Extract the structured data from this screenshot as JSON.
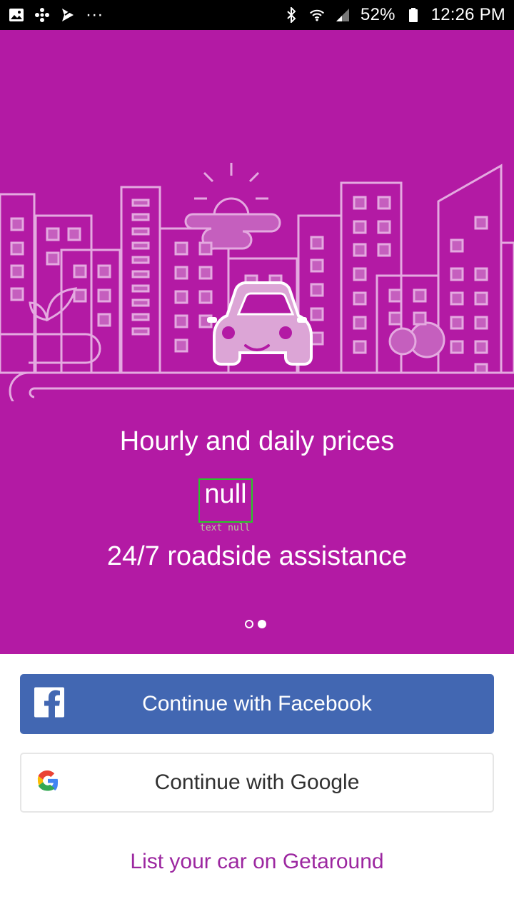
{
  "status_bar": {
    "battery": "52%",
    "time": "12:26 PM",
    "more": "···",
    "icons": [
      "gallery-icon",
      "fan-icon",
      "send-icon",
      "more-icon",
      "bluetooth-icon",
      "wifi-icon",
      "signal-icon",
      "battery-icon"
    ]
  },
  "hero": {
    "headline": "Hourly and daily prices",
    "placeholder": "null",
    "placeholder_caption": "text null",
    "subhead": "24/7 roadside assistance",
    "page_index": 2,
    "page_count": 2,
    "bg_color": "#B31AA4"
  },
  "buttons": {
    "facebook": {
      "label": "Continue with Facebook",
      "color": "#4267B2"
    },
    "google": {
      "label": "Continue with Google"
    }
  },
  "footer_link": {
    "label": "List your car on Getaround",
    "color": "#9C27A0"
  }
}
